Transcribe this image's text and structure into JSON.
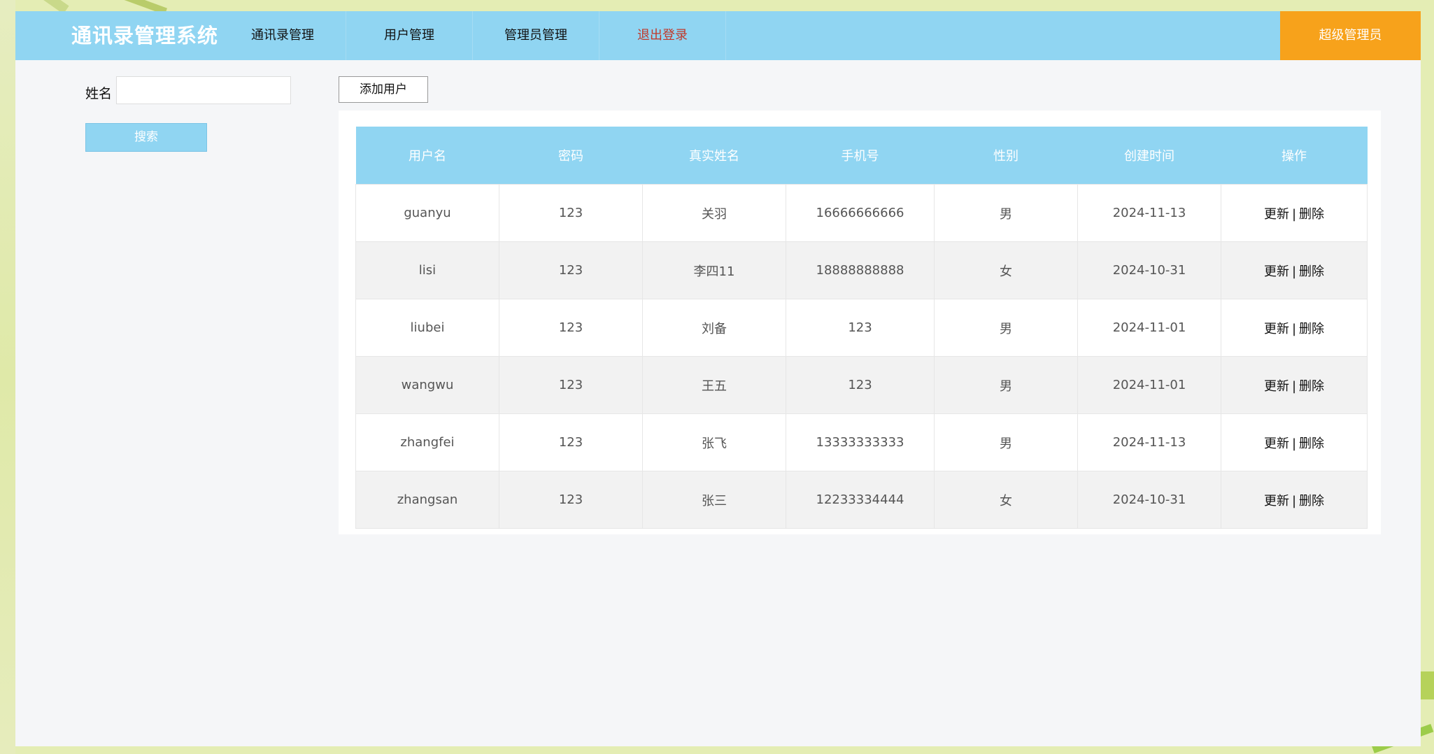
{
  "app": {
    "title": "通讯录管理系统",
    "nav": [
      "通讯录管理",
      "用户管理",
      "管理员管理",
      "退出登录"
    ],
    "role": "超级管理员"
  },
  "search": {
    "label": "姓名",
    "value": "",
    "placeholder": "",
    "button": "搜索"
  },
  "toolbar": {
    "add_label": "添加用户"
  },
  "table": {
    "columns": [
      "用户名",
      "密码",
      "真实姓名",
      "手机号",
      "性别",
      "创建时间",
      "操作"
    ],
    "rows": [
      {
        "username": "guanyu",
        "password": "123",
        "realname": "关羽",
        "phone": "16666666666",
        "gender": "男",
        "created": "2024-11-13"
      },
      {
        "username": "lisi",
        "password": "123",
        "realname": "李四11",
        "phone": "18888888888",
        "gender": "女",
        "created": "2024-10-31"
      },
      {
        "username": "liubei",
        "password": "123",
        "realname": "刘备",
        "phone": "123",
        "gender": "男",
        "created": "2024-11-01"
      },
      {
        "username": "wangwu",
        "password": "123",
        "realname": "王五",
        "phone": "123",
        "gender": "男",
        "created": "2024-11-01"
      },
      {
        "username": "zhangfei",
        "password": "123",
        "realname": "张飞",
        "phone": "13333333333",
        "gender": "男",
        "created": "2024-11-13"
      },
      {
        "username": "zhangsan",
        "password": "123",
        "realname": "张三",
        "phone": "12233334444",
        "gender": "女",
        "created": "2024-10-31"
      }
    ],
    "actions": {
      "update": "更新",
      "separator": "|",
      "delete": "删除"
    }
  },
  "colors": {
    "header": "#90d5f2",
    "admin": "#f7a21b",
    "logout": "#c0392b"
  }
}
